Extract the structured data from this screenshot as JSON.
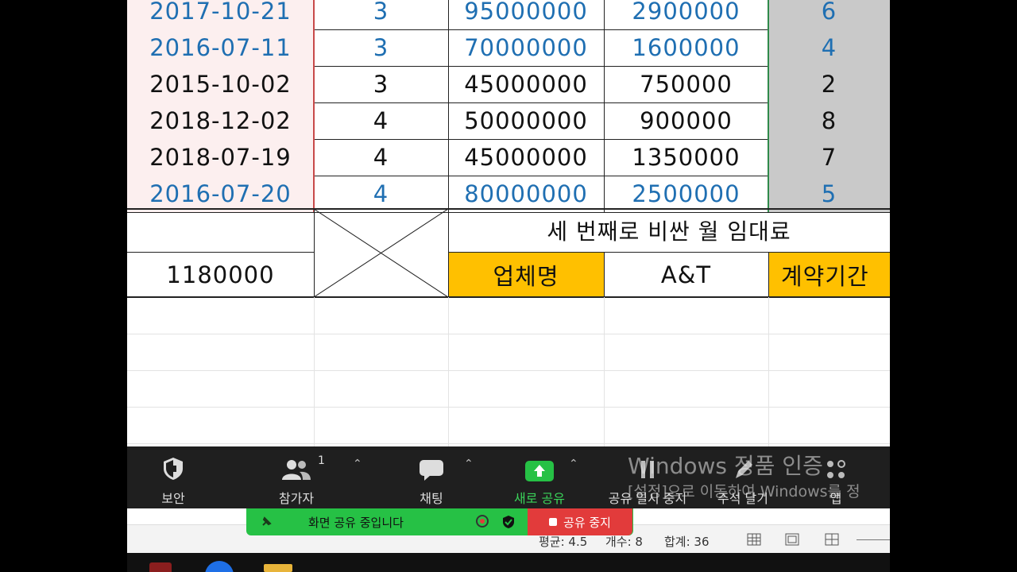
{
  "rows": [
    {
      "date": "2017-10-21",
      "count": "3",
      "deposit": "95000000",
      "rent": "2900000",
      "rank": "6",
      "blue": true
    },
    {
      "date": "2016-07-11",
      "count": "3",
      "deposit": "70000000",
      "rent": "1600000",
      "rank": "4",
      "blue": true
    },
    {
      "date": "2015-10-02",
      "count": "3",
      "deposit": "45000000",
      "rent": "750000",
      "rank": "2",
      "blue": false
    },
    {
      "date": "2018-12-02",
      "count": "4",
      "deposit": "50000000",
      "rent": "900000",
      "rank": "8",
      "blue": false
    },
    {
      "date": "2018-07-19",
      "count": "4",
      "deposit": "45000000",
      "rent": "1350000",
      "rank": "7",
      "blue": false
    },
    {
      "date": "2016-07-20",
      "count": "4",
      "deposit": "80000000",
      "rent": "2500000",
      "rank": "5",
      "blue": true
    }
  ],
  "summary": {
    "value": "1180000",
    "title": "세 번째로 비싼 월 임대료",
    "company_label": "업체명",
    "company_value": "A&T",
    "period_label": "계약기간"
  },
  "zoom": {
    "security": "보안",
    "participants": "참가자",
    "participants_count": "1",
    "chat": "채팅",
    "new_share": "새로 공유",
    "pause_share": "공유 일시 중지",
    "annotate": "주석 달기",
    "apps": "앱",
    "sharing_status": "화면 공유 중입니다",
    "stop_share": "공유 중지"
  },
  "watermark": {
    "line1": "Windows 정품 인증",
    "line2": "[설정]으로 이동하여 Windows를 정"
  },
  "status": {
    "average": "평균: 4.5",
    "count": "개수: 8",
    "sum": "합계: 36"
  },
  "colors": {
    "accent_orange": "#ffc000",
    "share_green": "#26c145",
    "stop_red": "#e23b3b",
    "value_blue": "#1f6fb2"
  }
}
